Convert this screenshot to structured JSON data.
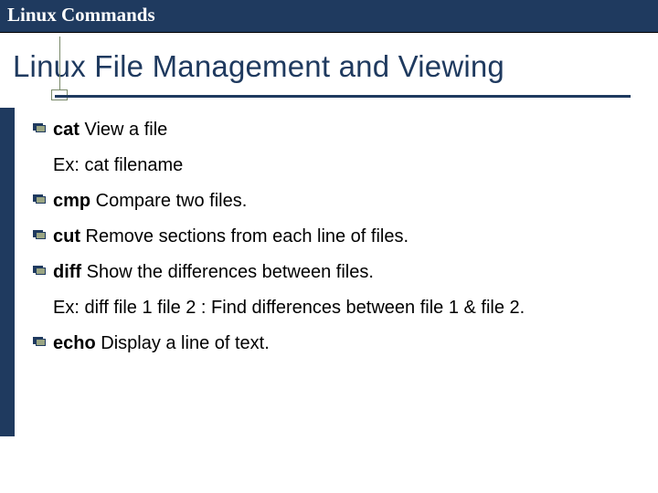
{
  "header": {
    "title": "Linux Commands"
  },
  "slide": {
    "title": "Linux File Management and Viewing"
  },
  "items": [
    {
      "cmd": "cat",
      "desc": " View a file",
      "example": "Ex: cat filename"
    },
    {
      "cmd": "cmp",
      "desc": " Compare two files."
    },
    {
      "cmd": "cut",
      "desc": " Remove sections from each line of files."
    },
    {
      "cmd": "diff",
      "desc": " Show the differences between files.",
      "example": "Ex: diff file 1 file 2 : Find differences between file 1 & file 2."
    },
    {
      "cmd": "echo",
      "desc": " Display a line of text."
    }
  ]
}
